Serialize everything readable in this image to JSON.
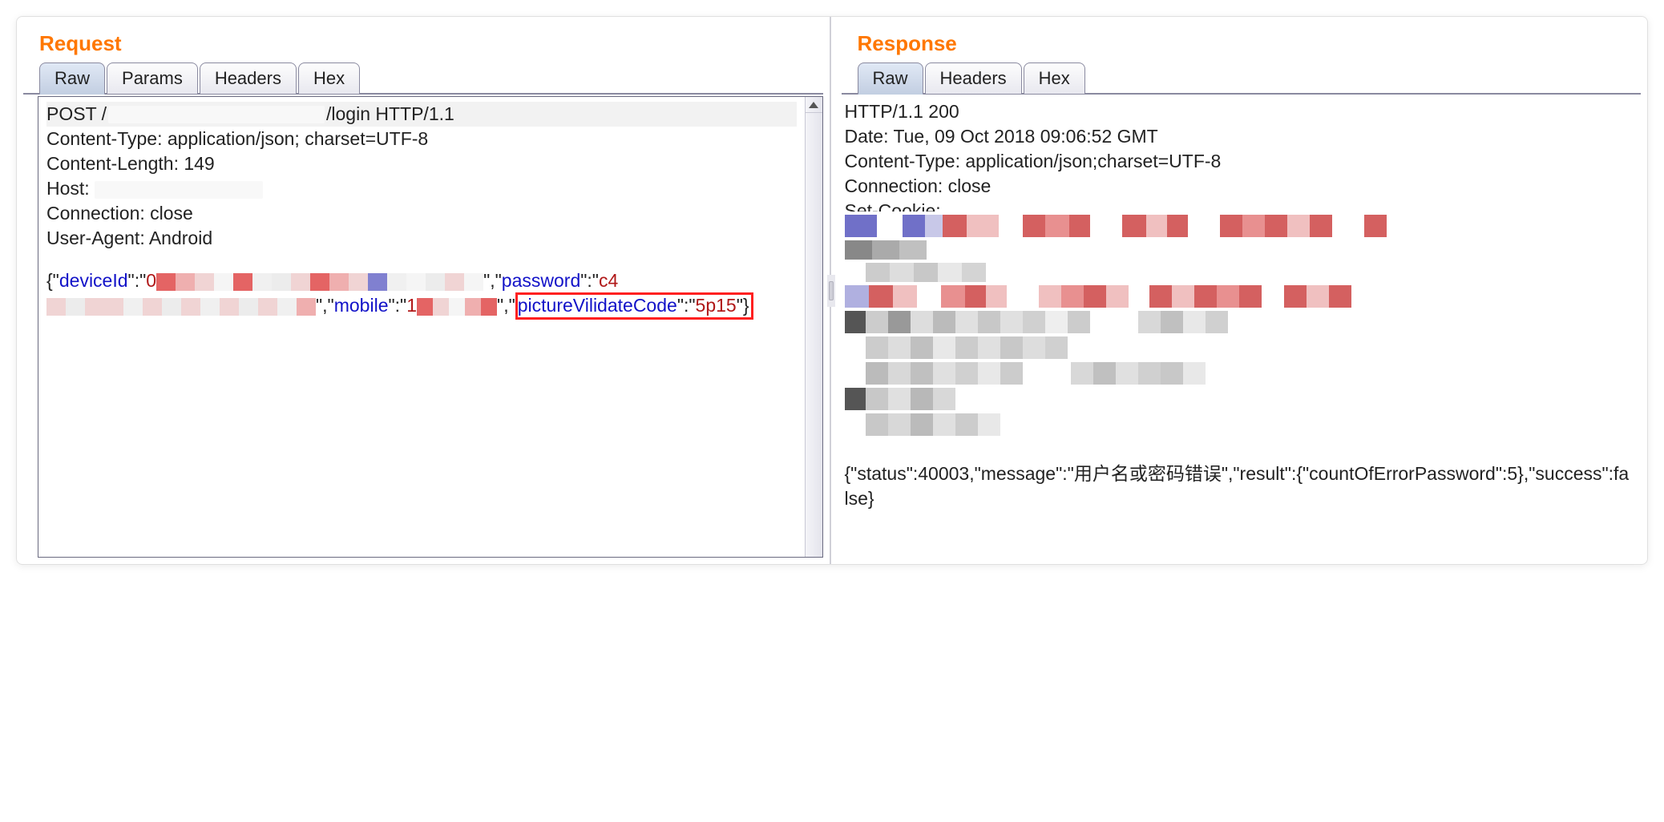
{
  "request": {
    "title": "Request",
    "tabs": [
      "Raw",
      "Params",
      "Headers",
      "Hex"
    ],
    "activeTab": 0,
    "firstline_pre": "POST /",
    "firstline_post": "/login HTTP/1.1",
    "headers": [
      "Content-Type: application/json; charset=UTF-8",
      "Content-Length: 149",
      "Host: ",
      "Connection: close",
      "User-Agent: Android"
    ],
    "body": {
      "open": "{\"",
      "k1": "deviceId",
      "mid1": "\":\"",
      "v1_prefix": "0",
      "mid2": "\",\"",
      "k2": "password",
      "mid3": "\":\"",
      "v2_prefix": "c4",
      "mid4": "\",\"",
      "k3": "mobile",
      "mid5": "\":\"",
      "v3_prefix": "1",
      "mid6": "\",\"",
      "k4": "pictureVilidateCode",
      "mid7": "\":\"",
      "v4": "5p15",
      "close": "\"}"
    }
  },
  "response": {
    "title": "Response",
    "tabs": [
      "Raw",
      "Headers",
      "Hex"
    ],
    "activeTab": 0,
    "headers": [
      "HTTP/1.1 200",
      "Date: Tue, 09 Oct 2018 09:06:52 GMT",
      "Content-Type: application/json;charset=UTF-8",
      "Connection: close",
      "Set-Cookie:"
    ],
    "body": "{\"status\":40003,\"message\":\"用户名或密码错误\",\"result\":{\"countOfErrorPassword\":5},\"success\":false}"
  }
}
